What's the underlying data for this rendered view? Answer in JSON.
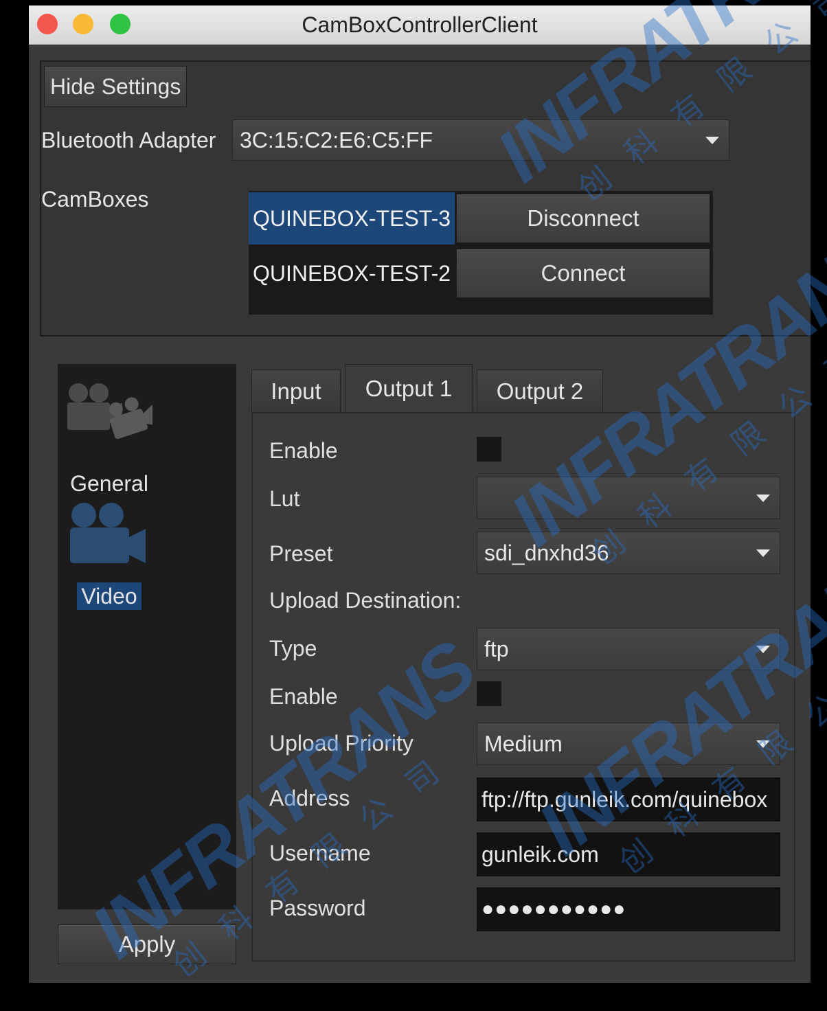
{
  "window": {
    "title": "CamBoxControllerClient"
  },
  "settings": {
    "hide_button": "Hide Settings",
    "bluetooth_label": "Bluetooth Adapter",
    "bluetooth_value": "3C:15:C2:E6:C5:FF",
    "camboxes_label": "CamBoxes",
    "camboxes": [
      {
        "name": "QUINEBOX-TEST-3",
        "action": "Disconnect",
        "selected": true
      },
      {
        "name": "QUINEBOX-TEST-2",
        "action": "Connect",
        "selected": false
      }
    ]
  },
  "sidebar": {
    "items": [
      {
        "label": "General",
        "icon": "cameras-icon",
        "active": false
      },
      {
        "label": "Video",
        "icon": "video-camera-icon",
        "active": true
      }
    ],
    "apply_button": "Apply"
  },
  "tabs": [
    {
      "label": "Input",
      "active": false
    },
    {
      "label": "Output 1",
      "active": true
    },
    {
      "label": "Output 2",
      "active": false
    }
  ],
  "output": {
    "enable_label": "Enable",
    "enable_checked": false,
    "lut_label": "Lut",
    "lut_value": "",
    "preset_label": "Preset",
    "preset_value": "sdi_dnxhd36",
    "upload_heading": "Upload Destination:",
    "type_label": "Type",
    "type_value": "ftp",
    "upload_enable_label": "Enable",
    "upload_enable_checked": false,
    "priority_label": "Upload Priority",
    "priority_value": "Medium",
    "address_label": "Address",
    "address_value": "ftp://ftp.gunleik.com/quinebox",
    "username_label": "Username",
    "username_value": "gunleik.com",
    "password_label": "Password",
    "password_value": "●●●●●●●●●●●"
  },
  "watermark": {
    "brand": "INFRATRANS",
    "chinese": "创科有限公司"
  }
}
